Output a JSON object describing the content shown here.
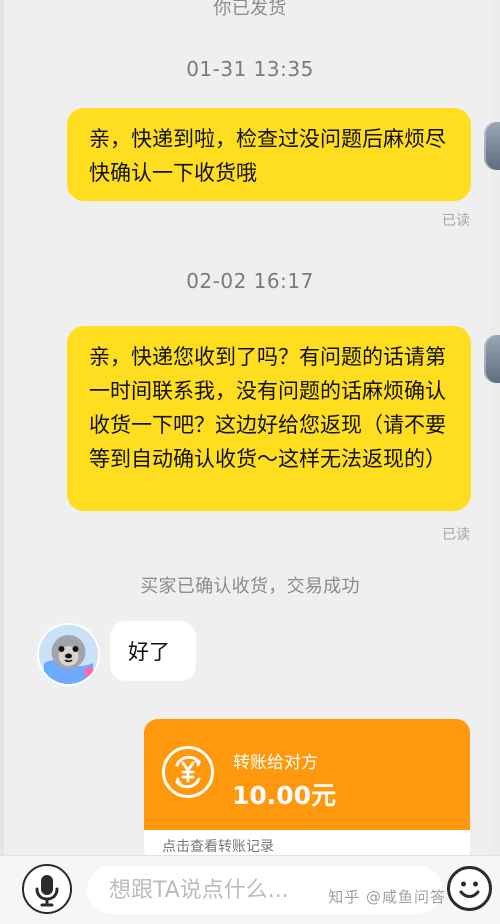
{
  "chat": {
    "system_top": "你已发货",
    "timestamps": {
      "first": "01-31 13:35",
      "second": "02-02 16:17"
    },
    "messages": {
      "outgoing_1": "亲，快递到啦，检查过没问题后麻烦尽快确认一下收货哦",
      "outgoing_2": "亲，快递您收到了吗？有问题的话请第一时间联系我，没有问题的话麻烦确认收货一下吧？这边好给您返现（请不要等到自动确认收货～这样无法返现的）",
      "incoming_1": "好了"
    },
    "read_status": "已读",
    "system_bottom": "买家已确认收货，交易成功"
  },
  "transfer": {
    "title": "转账给对方",
    "amount": "10.00元",
    "footer": "点击查看转账记录",
    "accent_color": "#ff980c"
  },
  "composer": {
    "placeholder": "想跟TA说点什么..."
  },
  "watermark": {
    "text": "知乎 @咸鱼问答"
  },
  "colors": {
    "background": "#efefef",
    "outgoing_bubble": "#ffde1f",
    "incoming_bubble": "#ffffff"
  },
  "icons": {
    "microphone": "microphone-icon",
    "emoji": "emoji-icon",
    "transfer": "yen-transfer-icon",
    "seal_avatar": "seal-avatar"
  }
}
